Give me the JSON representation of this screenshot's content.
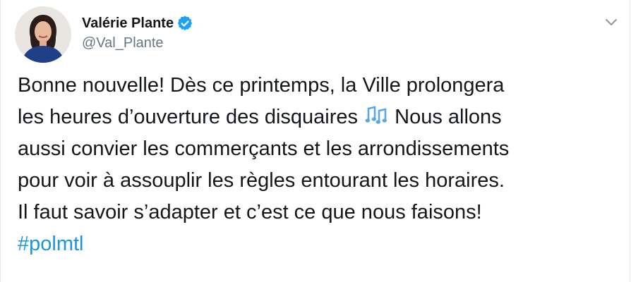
{
  "author": {
    "display_name": "Valérie Plante",
    "handle": "@Val_Plante",
    "verified": true,
    "avatar_icon": "profile-photo"
  },
  "menu": {
    "icon": "chevron-down-icon"
  },
  "tweet": {
    "line_1": "Bonne nouvelle! Dès ce printemps, la Ville prolongera",
    "line_2_before_emoji": "les heures d’ouverture des disquaires",
    "emoji": "musical-notes-icon",
    "line_2_after_emoji": "Nous allons",
    "line_3": "aussi convier les commerçants et les arrondissements",
    "line_4": "pour voir à assouplir les règles entourant les horaires.",
    "line_5": "Il faut savoir s’adapter et c’est ce que nous faisons!",
    "hashtag": "#polmtl"
  },
  "colors": {
    "text": "#14171a",
    "secondary_text": "#657786",
    "link": "#1b95e0",
    "verified_badge": "#1da1f2",
    "border": "#e1e8ed"
  }
}
